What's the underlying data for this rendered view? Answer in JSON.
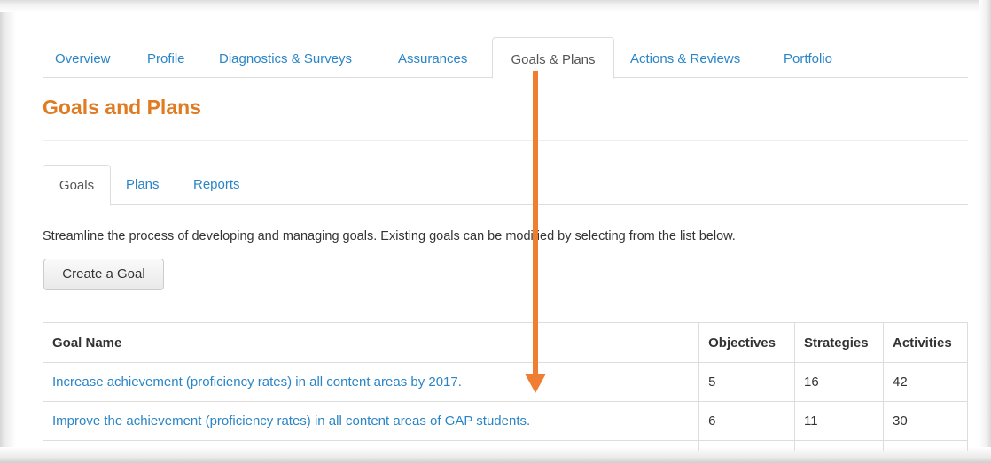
{
  "main_tabs": [
    {
      "label": "Overview"
    },
    {
      "label": "Profile"
    },
    {
      "label": "Diagnostics & Surveys"
    },
    {
      "label": "Assurances"
    },
    {
      "label": "Goals & Plans",
      "active": true
    },
    {
      "label": "Actions & Reviews"
    },
    {
      "label": "Portfolio"
    }
  ],
  "page": {
    "title": "Goals and Plans",
    "intro": "Streamline the process of developing and managing goals. Existing goals can be modified by selecting from the list below.",
    "create_button": "Create a Goal"
  },
  "sub_tabs": [
    {
      "label": "Goals",
      "active": true
    },
    {
      "label": "Plans"
    },
    {
      "label": "Reports"
    }
  ],
  "table": {
    "headers": [
      "Goal Name",
      "Objectives",
      "Strategies",
      "Activities"
    ],
    "rows": [
      {
        "name": "Increase achievement (proficiency rates) in all content areas by 2017.",
        "objectives": "5",
        "strategies": "16",
        "activities": "42"
      },
      {
        "name": "Improve the achievement (proficiency rates) in all content areas of GAP students.",
        "objectives": "6",
        "strategies": "11",
        "activities": "30"
      }
    ]
  },
  "colors": {
    "link": "#2a85c7",
    "title": "#e07b22",
    "annotation_arrow": "#ef7d32"
  }
}
